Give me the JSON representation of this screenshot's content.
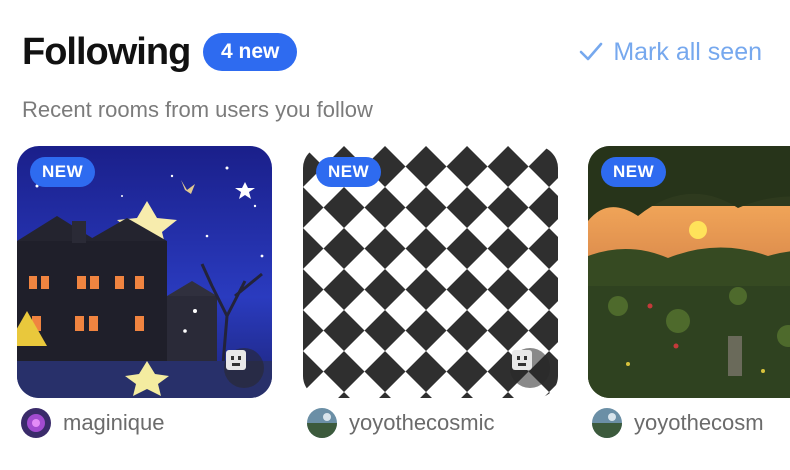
{
  "header": {
    "title": "Following",
    "new_count": "4 new",
    "mark_all_seen": "Mark all seen"
  },
  "subtitle": "Recent rooms from users you follow",
  "rooms": [
    {
      "badge": "NEW",
      "owner": "maginique",
      "has_avatar_chip": true
    },
    {
      "badge": "NEW",
      "owner": "yoyothecosmic",
      "has_avatar_chip": true
    },
    {
      "badge": "NEW",
      "owner": "yoyothecosm",
      "has_avatar_chip": false
    }
  ],
  "colors": {
    "accent": "#2e6bf0",
    "mark_seen": "#76a8ee",
    "title": "#111111",
    "muted": "#7b7b7b"
  },
  "icons": {
    "check": "check-icon",
    "avatar_chip": "blocky-avatar-icon"
  }
}
